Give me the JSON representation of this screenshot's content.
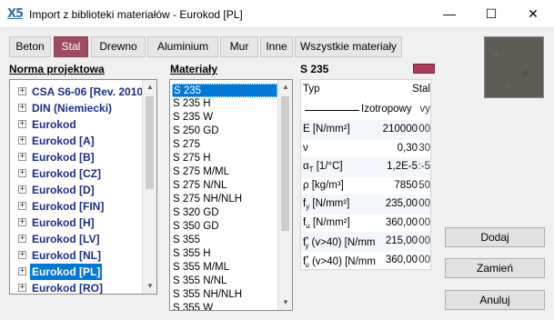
{
  "window": {
    "logo": "X5",
    "title": "Import z biblioteki materiałów - Eurokod [PL]",
    "minimize": "—",
    "maximize": "☐",
    "close": "✕"
  },
  "tabs": [
    {
      "label": "Beton",
      "active": false
    },
    {
      "label": "Stal",
      "active": true
    },
    {
      "label": "Drewno",
      "active": false
    },
    {
      "label": "Aluminium",
      "active": false
    },
    {
      "label": "Mur",
      "active": false
    },
    {
      "label": "Inne",
      "active": false
    },
    {
      "label": "Wszystkie materiały",
      "active": false
    }
  ],
  "norms": {
    "header": "Norma projektowa",
    "items": [
      "CSA S6-06 [Rev. 2010",
      "DIN (Niemiecki)",
      "Eurokod",
      "Eurokod [A]",
      "Eurokod [B]",
      "Eurokod [CZ]",
      "Eurokod [D]",
      "Eurokod [FIN]",
      "Eurokod [H]",
      "Eurokod [LV]",
      "Eurokod [NL]",
      "Eurokod [PL]",
      "Eurokod [RO]"
    ],
    "selected": "Eurokod [PL]"
  },
  "materials": {
    "header": "Materiały",
    "items": [
      "S 235",
      "S 235 H",
      "S 235 W",
      "S 250 GD",
      "S 275",
      "S 275 H",
      "S 275 M/ML",
      "S 275 N/NL",
      "S 275 NH/NLH",
      "S 320 GD",
      "S 350 GD",
      "S 355",
      "S 355 H",
      "S 355 M/ML",
      "S 355 N/NL",
      "S 355 NH/NLH",
      "S 355 W"
    ],
    "selected": "S 235"
  },
  "details": {
    "material_name": "S 235",
    "color": "#b03a5b",
    "type_label": "Typ",
    "type_value": "Stal",
    "isotropy": "Izotropowy",
    "isotropy_suffix": "vy",
    "props": [
      {
        "name": "E [N/mm²]",
        "value": "210000",
        "suffix": "00"
      },
      {
        "name": "ν",
        "value": "0,30",
        "suffix": "30"
      },
      {
        "name": "α",
        "name_sub": "T",
        "name_tail": " [1/°C]",
        "value": "1,2E-5",
        "suffix": ":-5"
      },
      {
        "name": "ρ [kg/m³]",
        "value": "7850",
        "suffix": "50"
      },
      {
        "name": "f",
        "name_sub": "y",
        "name_tail": " [N/mm²]",
        "value": "235,00",
        "suffix": "00"
      },
      {
        "name": "f",
        "name_sub": "u",
        "name_tail": " [N/mm²]",
        "value": "360,00",
        "suffix": "00"
      },
      {
        "name": "f",
        "name_sub": "y",
        "name_sup": "*",
        "name_tail": " (v>40) [N/mm",
        "value": "215,00",
        "suffix": "00"
      },
      {
        "name": "f",
        "name_sub": "u",
        "name_sup": "*",
        "name_tail": " (v>40) [N/mm",
        "value": "360,00",
        "suffix": "00"
      }
    ]
  },
  "buttons": {
    "add": "Dodaj",
    "replace": "Zamień",
    "cancel": "Anuluj"
  }
}
